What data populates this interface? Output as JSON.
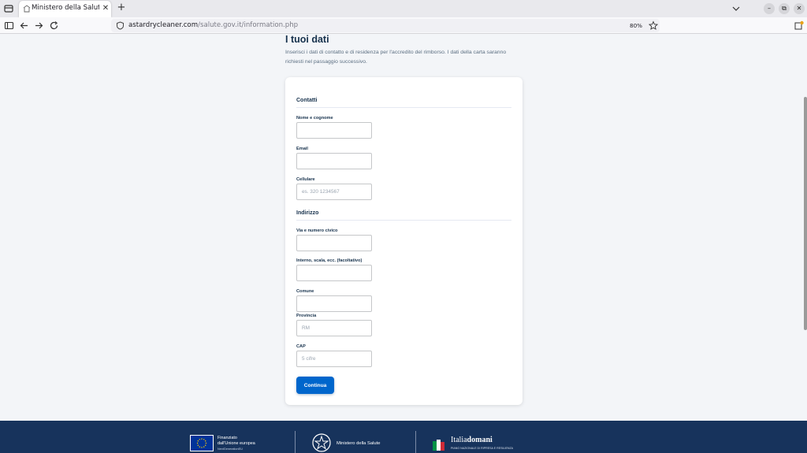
{
  "browser": {
    "tab_title": "Ministero della Salute - Li",
    "url_host": "astardrycleaner.com",
    "url_path": "/salute.gov.it/information.php",
    "zoom": "80%"
  },
  "page": {
    "heading": "I tuoi dati",
    "intro": "Inserisci i dati di contatto e di residenza per l'accredito del rimborso. I dati della carta saranno richiesti nel passaggio successivo."
  },
  "form": {
    "section_contacts": "Contatti",
    "name_label": "Nome e cognome",
    "email_label": "Email",
    "phone_label": "Cellulare",
    "phone_placeholder": "es. 320 1234567",
    "section_address": "Indirizzo",
    "street_label": "Via e numero civico",
    "interior_label": "Interno, scala, ecc. (facoltativo)",
    "city_label": "Comune",
    "province_label": "Provincia",
    "province_placeholder": "RM",
    "zip_label": "CAP",
    "zip_placeholder": "5 cifre",
    "submit_label": "Continua"
  },
  "footer": {
    "eu_line1": "Finanziato",
    "eu_line2": "dall'Unione europea",
    "eu_line3": "NextGenerationEU",
    "ministry": "Ministero della Salute",
    "italia_a": "Italia",
    "italia_b": "domani",
    "italia_sub": "PIANO NAZIONALE DI RIPRESA E RESILIENZA"
  },
  "colors": {
    "primary": "#0066cc",
    "text": "#17324d",
    "footer": "#17335c"
  }
}
